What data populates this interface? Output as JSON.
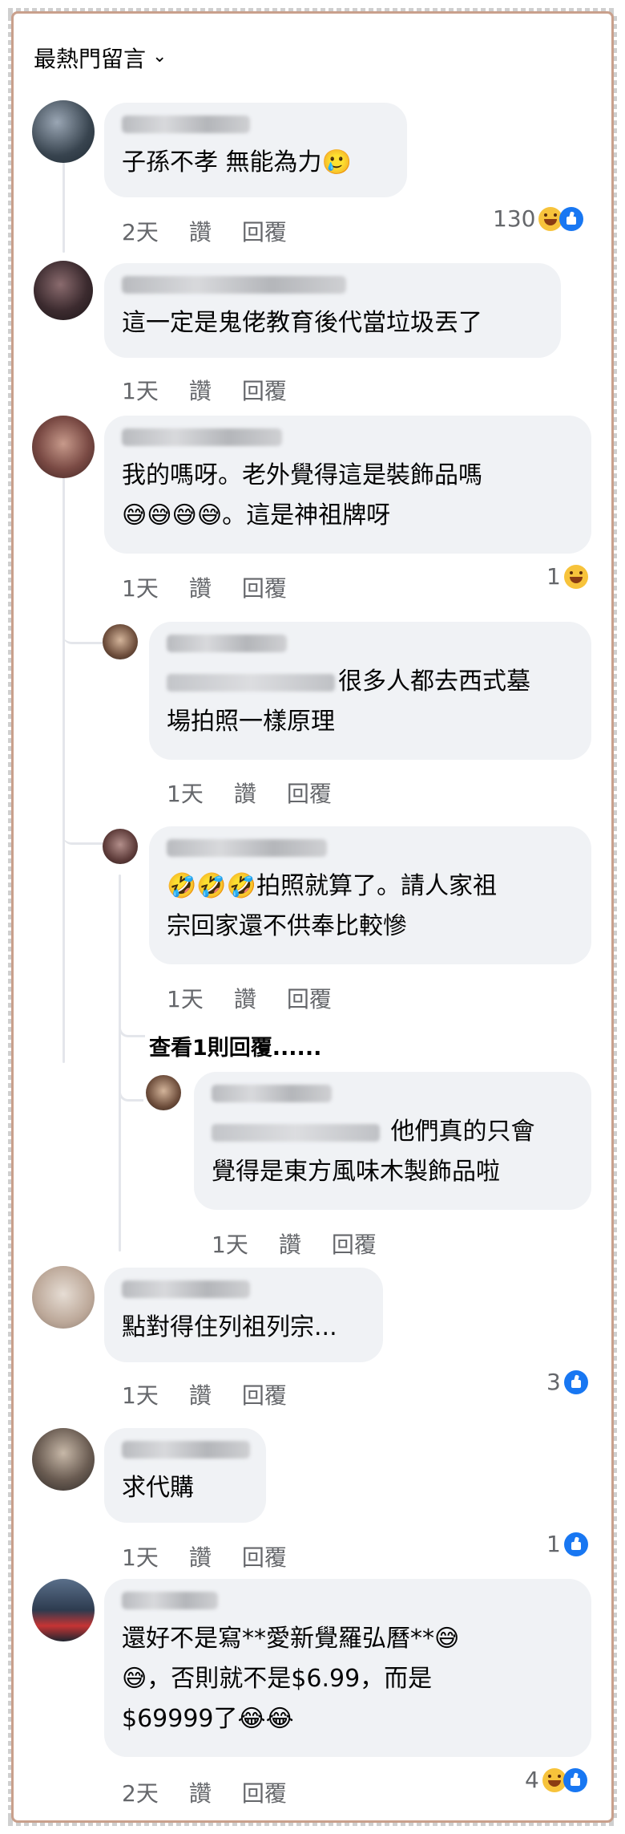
{
  "header": {
    "sort_label": "最熱門留言"
  },
  "comments": [
    {
      "text": "子孫不孝 無能為力🥲",
      "time": "2天",
      "like": "讚",
      "reply": "回覆",
      "reactions": "130"
    },
    {
      "text": "這一定是鬼佬教育後代當垃圾丟了",
      "time": "1天",
      "like": "讚",
      "reply": "回覆"
    },
    {
      "text": "我的嗎呀。老外覺得這是裝飾品嗎\n😅😅😅😅。這是神祖牌呀",
      "time": "1天",
      "like": "讚",
      "reply": "回覆",
      "reactions": "1"
    },
    {
      "text_a": "很多人都去西式墓",
      "text_b": "場拍照一樣原理",
      "time": "1天",
      "like": "讚",
      "reply": "回覆"
    },
    {
      "text": "🤣🤣🤣拍照就算了。請人家祖\n宗回家還不供奉比較慘",
      "time": "1天",
      "like": "讚",
      "reply": "回覆"
    },
    {
      "text_a": " 他們真的只會",
      "text_b": "覺得是東方風味木製飾品啦",
      "time": "1天",
      "like": "讚",
      "reply": "回覆"
    },
    {
      "text": "點對得住列祖列宗...",
      "time": "1天",
      "like": "讚",
      "reply": "回覆",
      "reactions": "3"
    },
    {
      "text": "求代購",
      "time": "1天",
      "like": "讚",
      "reply": "回覆",
      "reactions": "1"
    },
    {
      "text": "還好不是寫**愛新覺羅弘曆**😅\n😅，否則就不是$6.99，而是\n$69999了😂😂",
      "time": "2天",
      "like": "讚",
      "reply": "回覆",
      "reactions": "4"
    }
  ],
  "view_more": "查看1則回覆......",
  "colors": {
    "bubble": "#f0f2f5",
    "meta": "#65676b",
    "like_blue": "#1877f2",
    "frame": "#c9a08c"
  }
}
